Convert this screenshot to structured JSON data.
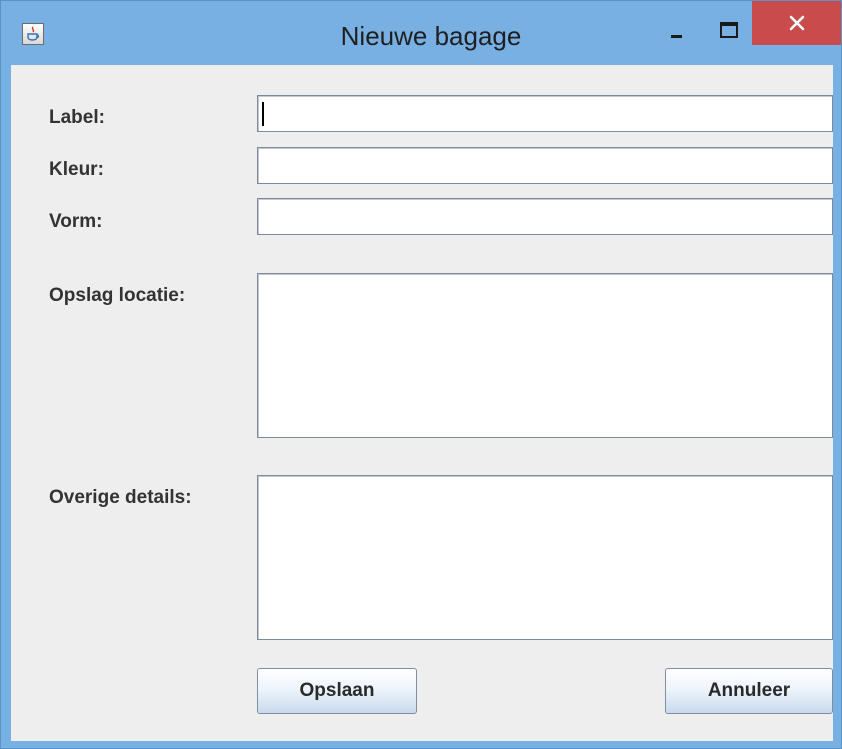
{
  "window": {
    "title": "Nieuwe bagage",
    "icon": "java-cup-icon",
    "controls": [
      "minimize",
      "maximize",
      "close"
    ],
    "close_color": "#c94b4b",
    "titlebar_color": "#78b0e4"
  },
  "form": {
    "label_label": "Label:",
    "label_value": "",
    "kleur_label": "Kleur:",
    "kleur_value": "",
    "vorm_label": "Vorm:",
    "vorm_value": "",
    "opslag_label": "Opslag locatie:",
    "opslag_value": "",
    "overige_label": "Overige details:",
    "overige_value": ""
  },
  "buttons": {
    "save_label": "Opslaan",
    "cancel_label": "Annuleer"
  }
}
